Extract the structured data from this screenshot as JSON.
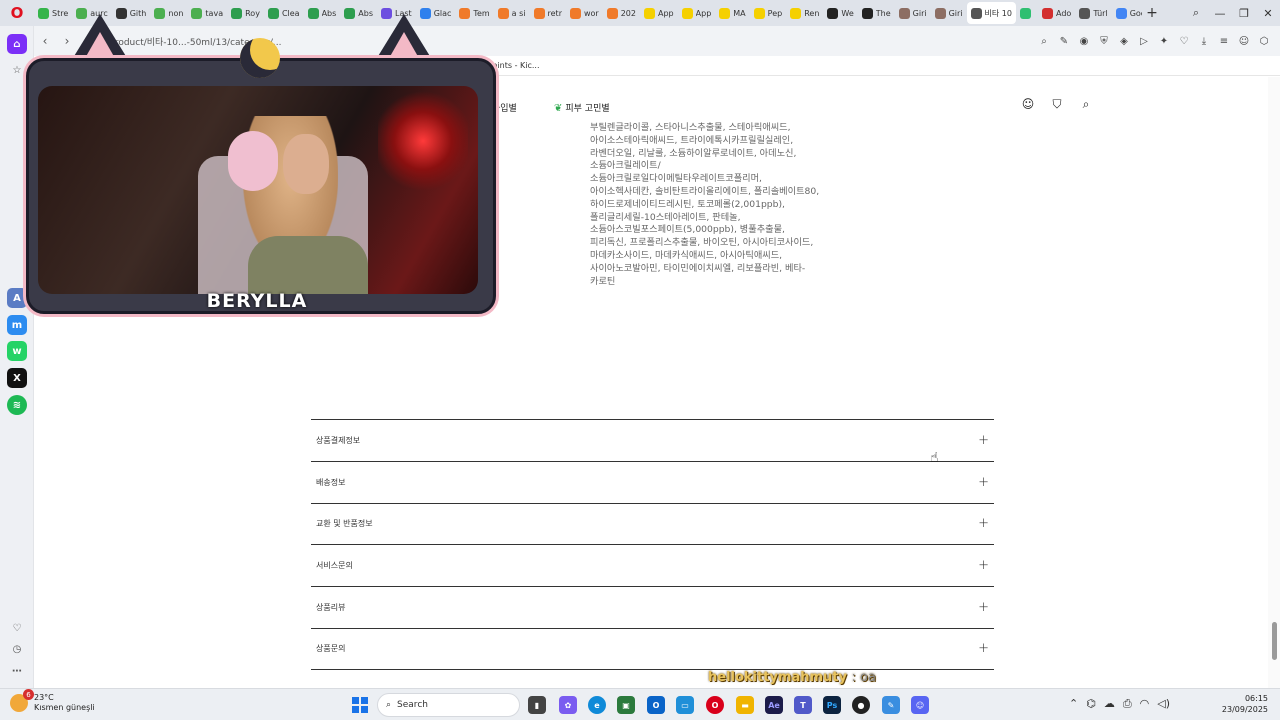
{
  "browser": {
    "tabs": [
      {
        "label": "Stre",
        "color": "#35b44a"
      },
      {
        "label": "aurc",
        "color": "#4caf50"
      },
      {
        "label": "Gith",
        "color": "#333333"
      },
      {
        "label": "non",
        "color": "#4caf50"
      },
      {
        "label": "tava",
        "color": "#4caf50"
      },
      {
        "label": "Roy",
        "color": "#2e9e4f"
      },
      {
        "label": "Clea",
        "color": "#2e9e4f"
      },
      {
        "label": "Abs",
        "color": "#2e9e4f"
      },
      {
        "label": "Abs",
        "color": "#2e9e4f"
      },
      {
        "label": "Last",
        "color": "#6c4ee0"
      },
      {
        "label": "Glac",
        "color": "#2f80ed"
      },
      {
        "label": "Tem",
        "color": "#f07a2a"
      },
      {
        "label": "a si",
        "color": "#f07a2a"
      },
      {
        "label": "retr",
        "color": "#f07a2a"
      },
      {
        "label": "wor",
        "color": "#f07a2a"
      },
      {
        "label": "202",
        "color": "#f07a2a"
      },
      {
        "label": "App",
        "color": "#f5d000"
      },
      {
        "label": "App",
        "color": "#f5d000"
      },
      {
        "label": "MA",
        "color": "#f5d000"
      },
      {
        "label": "Pep",
        "color": "#f5d000"
      },
      {
        "label": "Ren",
        "color": "#f5d000"
      },
      {
        "label": "We",
        "color": "#222222"
      },
      {
        "label": "The",
        "color": "#222222"
      },
      {
        "label": "Giri",
        "color": "#8d6e63"
      },
      {
        "label": "Giri",
        "color": "#8d6e63"
      },
      {
        "label": "비타 10",
        "color": "#555555",
        "active": true
      },
      {
        "label": "",
        "color": "#2fbf71"
      },
      {
        "label": "Ado",
        "color": "#d32f2f"
      },
      {
        "label": "Türl",
        "color": "#555555"
      },
      {
        "label": "Goc",
        "color": "#4285f4"
      }
    ],
    "url": "co.kr/product/비타-10...-50ml/13/category/...",
    "bookmark_text": "Points - Kic..."
  },
  "site": {
    "nav_type": "타입별",
    "nav_concern": "피부 고민별",
    "ingredients": "부틸렌글라이콜, 스타아니스추출물, 스테아릭애씨드, 아이소스테아릭애씨드, 트라이에톡시카프릴릴실레인, 라벤더오일, 리날룰, 소듐하이알루로네이트, 아데노신, 소듐아크릴레이트/소듐아크릴로일다이메틸타우레이트코폴리머, 아이소헥사데칸, 솔비탄트라이올리에이트, 폴리솔베이트80, 하이드로제네이티드레시틴, 토코페롤(2,001ppb), 폴리글리세릴-10스테아레이트, 판테놀, 소듐아스코빌포스페이트(5,000ppb), 병풀추출물, 피리독신, 프로폴리스추출물, 바이오틴, 아시아티코사이드, 마데카소사이드, 마데카식애씨드, 아시아틱애씨드, 사이아노코발아민, 타이민에이치씨엘, 리보플라빈, 베타-카로틴"
  },
  "accordion": [
    {
      "label": "상품결제정보"
    },
    {
      "label": "배송정보"
    },
    {
      "label": "교환 및 반품정보"
    },
    {
      "label": "서비스문의"
    },
    {
      "label": "상품리뷰"
    },
    {
      "label": "상품문의"
    }
  ],
  "overlay": {
    "streamer_name": "BERYLLA",
    "chat_user": "hellokittymahmuty",
    "chat_message": ": oa"
  },
  "taskbar": {
    "weather_temp": "23°C",
    "weather_desc": "Kısmen güneşli",
    "weather_badge": "6",
    "search_placeholder": "Search",
    "time": "06:15",
    "date": "23/09/2025"
  }
}
